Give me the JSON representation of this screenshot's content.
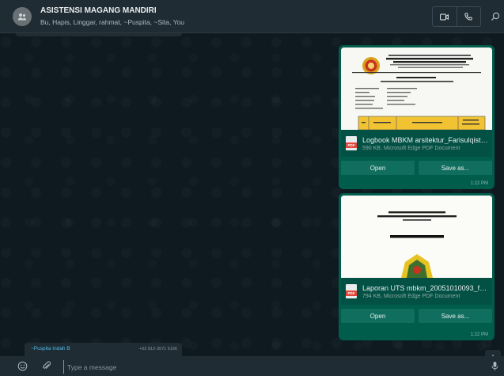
{
  "header": {
    "title": "ASISTENSI MAGANG MANDIRI",
    "members": "Bu, Hapis, Linggar, rahmat, ~Puspita, ~Sita, You"
  },
  "messages": [
    {
      "file_name": "Logbook MBKM arsitektur_Farisulqisthi...",
      "file_size": "590 KB, Microsoft Edge PDF Document",
      "open_label": "Open",
      "save_label": "Save as...",
      "time": "1:22 PM"
    },
    {
      "file_name": "Laporan UTS mbkm_20051010093_faris...",
      "file_size": "794 KB, Microsoft Edge PDF Document",
      "open_label": "Open",
      "save_label": "Save as...",
      "time": "1:22 PM"
    }
  ],
  "sender": {
    "name": "~Puspita Indah B",
    "number": "+62 812-3571 6166"
  },
  "composer": {
    "placeholder": "Type a message"
  },
  "colors": {
    "header_bg": "#202c33",
    "chat_bg": "#0e1a20",
    "outgoing_bubble": "#005c4b",
    "pdf_red": "#e0473a"
  }
}
